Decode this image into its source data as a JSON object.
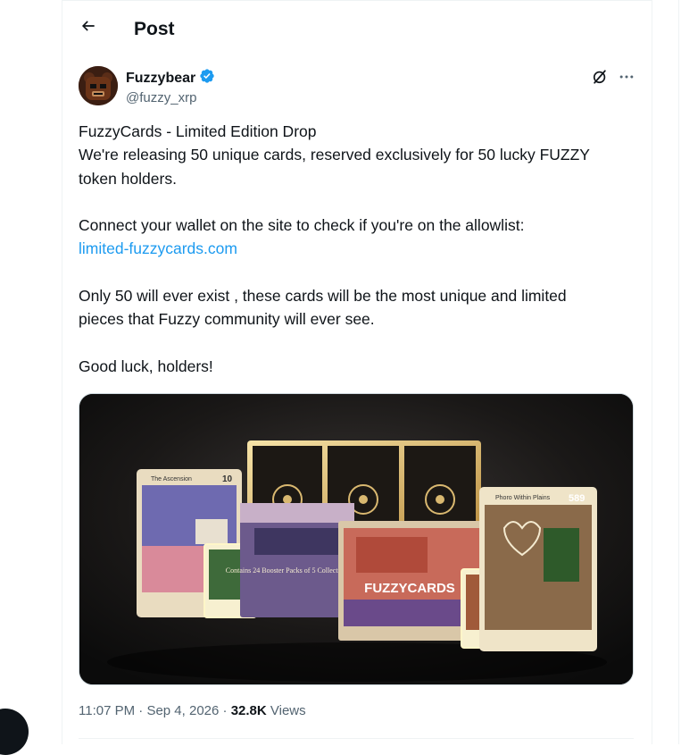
{
  "header": {
    "title": "Post"
  },
  "post": {
    "author": {
      "display_name": "Fuzzybear",
      "handle": "@fuzzy_xrp",
      "verified": true
    },
    "text_lines": [
      "FuzzyCards - Limited Edition Drop",
      "We're releasing 50 unique cards, reserved exclusively for 50 lucky FUZZY",
      "token holders.",
      "",
      "Connect your wallet on the site to check if you're on the allowlist:",
      "limited-fuzzycards.com",
      "",
      "Only 50 will ever exist , these cards will be the most unique and limited",
      "pieces that Fuzzy community will ever see.",
      "",
      "Good luck, holders!"
    ],
    "link": "limited-fuzzycards.com",
    "media": {
      "box_text": "FUZZYCARDS",
      "box_subtext": "Contains 24 Booster Packs of 5 Collectible Cards.",
      "card_left": {
        "title": "The Ascension",
        "number": "10"
      },
      "card_right": {
        "title": "Phoro Within Plains",
        "number": "589"
      }
    },
    "meta": {
      "time": "11:07 PM",
      "separator": "·",
      "date": "Sep 4, 2026",
      "views_count": "32.8K",
      "views_label": "Views"
    }
  },
  "icons": {
    "back": "arrow-left-icon",
    "verified": "verified-badge-icon",
    "grok": "grok-icon",
    "more": "more-horizontal-icon"
  },
  "colors": {
    "link": "#1d9bf0",
    "verified": "#1d9bf0",
    "secondary_text": "#536471"
  }
}
